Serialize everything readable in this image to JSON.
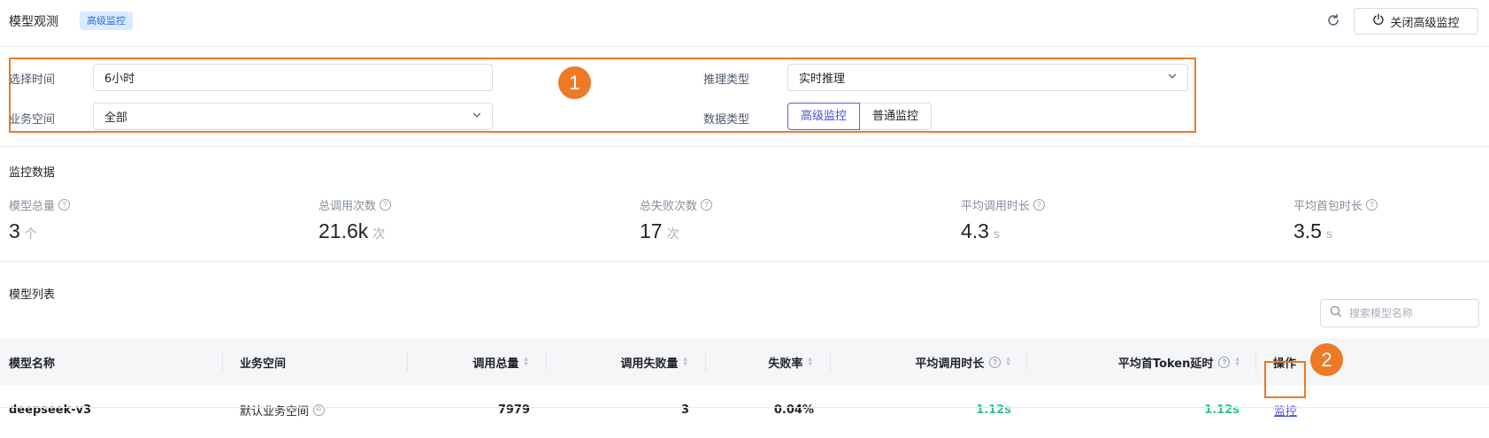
{
  "header": {
    "title": "模型观测",
    "badge": "高级监控",
    "close_button_label": "关闭高级监控",
    "refresh_icon": "refresh-icon",
    "power_icon": "power-icon"
  },
  "filters": {
    "annotation_number": "1",
    "time": {
      "label": "选择时间",
      "value": "6小时"
    },
    "inference_type": {
      "label": "推理类型",
      "value": "实时推理"
    },
    "workspace": {
      "label": "业务空间",
      "value": "全部"
    },
    "data_type": {
      "label": "数据类型",
      "options": [
        "高级监控",
        "普通监控"
      ],
      "selected": "高级监控"
    }
  },
  "stats": {
    "title": "监控数据",
    "items": [
      {
        "label": "模型总量",
        "value": "3",
        "unit": "个"
      },
      {
        "label": "总调用次数",
        "value": "21.6k",
        "unit": "次"
      },
      {
        "label": "总失败次数",
        "value": "17",
        "unit": "次"
      },
      {
        "label": "平均调用时长",
        "value": "4.3",
        "unit": "s"
      },
      {
        "label": "平均首包时长",
        "value": "3.5",
        "unit": "s"
      }
    ]
  },
  "list": {
    "title": "模型列表",
    "search_placeholder": "搜索模型名称",
    "columns": [
      "模型名称",
      "业务空间",
      "调用总量",
      "调用失败量",
      "失败率",
      "平均调用时长",
      "平均首Token延时",
      "操作"
    ],
    "rows": [
      {
        "name": "deepseek-v3",
        "workspace": "默认业务空间",
        "total_calls": "7979",
        "failed_calls": "3",
        "failure_rate": "0.04%",
        "avg_call_duration": "1.12s",
        "avg_first_token_latency": "1.12s",
        "action": "监控"
      }
    ],
    "annotation_number": "2"
  },
  "colors": {
    "accent": "#4b4fd6",
    "annotation": "#ec7a27",
    "success": "#34c38f",
    "badge_bg": "#d8ecff"
  }
}
